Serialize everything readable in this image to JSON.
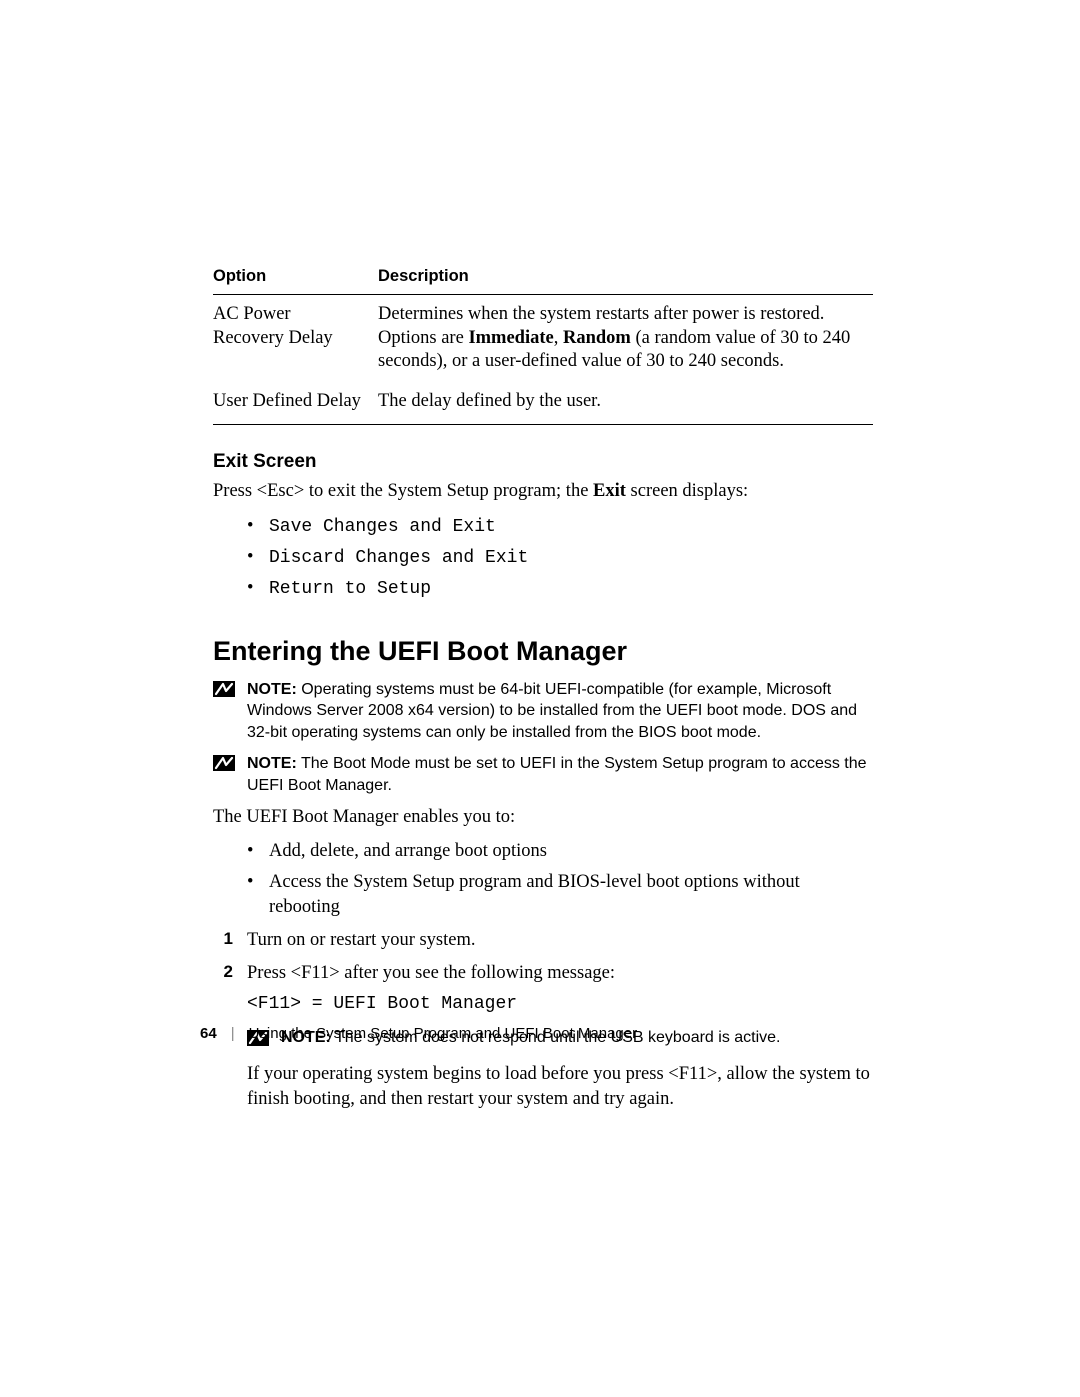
{
  "table": {
    "headers": {
      "option": "Option",
      "description": "Description"
    },
    "rows": [
      {
        "option": "AC Power Recovery Delay",
        "desc_pre": "Determines when the system restarts after power is restored. Options are ",
        "desc_b1": "Immediate",
        "desc_mid": ", ",
        "desc_b2": "Random",
        "desc_post": " (a random value of 30 to 240 seconds), or a user-defined value of 30 to 240 seconds."
      },
      {
        "option": "User Defined Delay",
        "desc": "The delay defined by the user."
      }
    ]
  },
  "exit": {
    "heading": "Exit Screen",
    "intro_pre": "Press <Esc> to exit the System Setup program; the ",
    "intro_b": "Exit",
    "intro_post": " screen displays:",
    "items": [
      "Save Changes and Exit",
      "Discard Changes and Exit",
      "Return to Setup"
    ]
  },
  "uefi": {
    "heading": "Entering the UEFI Boot Manager",
    "note1": {
      "label": "NOTE:",
      "text": " Operating systems must be 64-bit UEFI-compatible (for example, Microsoft Windows Server 2008 x64 version) to be installed from the UEFI boot mode. DOS and 32-bit operating systems can only be installed from the BIOS boot mode."
    },
    "note2": {
      "label": "NOTE:",
      "text": " The Boot Mode must be set to UEFI in the System Setup program to access the UEFI Boot Manager."
    },
    "intro": "The UEFI Boot Manager enables you to:",
    "bullets": [
      "Add, delete, and arrange boot options",
      "Access the System Setup program and BIOS-level boot options without rebooting"
    ],
    "steps": {
      "s1": "Turn on or restart your system.",
      "s2": "Press <F11> after you see the following message:",
      "s2_code": "<F11> = UEFI Boot Manager",
      "s2_note": {
        "label": "NOTE:",
        "text": " The system does not respond until the USB keyboard is active."
      },
      "s2_tail": "If your operating system begins to load before you press <F11>, allow the system to finish booting, and then restart your system and try again."
    }
  },
  "footer": {
    "page": "64",
    "sep": "|",
    "chapter": "Using the System Setup Program and UEFI Boot Manager"
  }
}
